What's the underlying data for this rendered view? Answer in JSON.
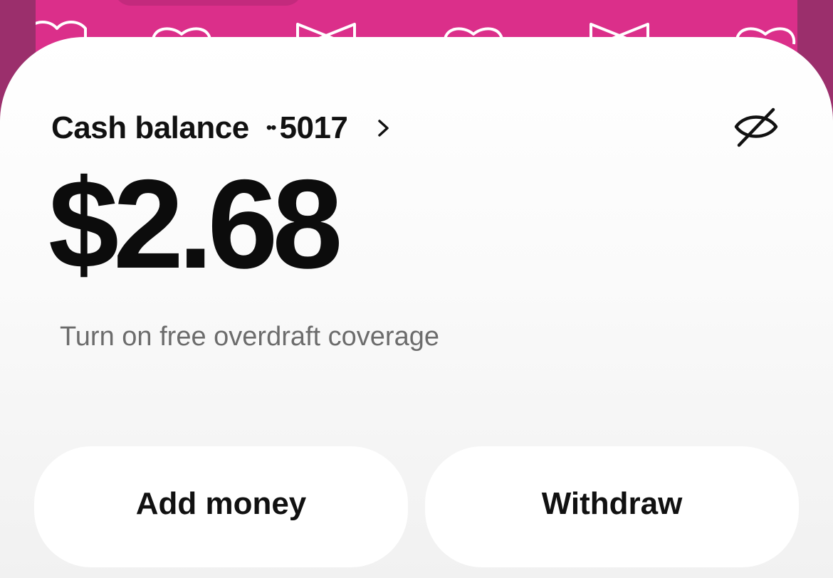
{
  "theme": {
    "accent": "#db2f8a",
    "frame": "#9b2f6c",
    "text": "#111111",
    "muted": "#6c6c6c"
  },
  "header": {
    "title": "Cash balance",
    "account_dots": "••",
    "account_last4": "5017",
    "chevron_icon": "chevron-right",
    "hide_icon": "eye-slash"
  },
  "balance": "$2.68",
  "overdraft_link": "Turn on free overdraft coverage",
  "actions": {
    "add_money": "Add money",
    "withdraw": "Withdraw"
  }
}
